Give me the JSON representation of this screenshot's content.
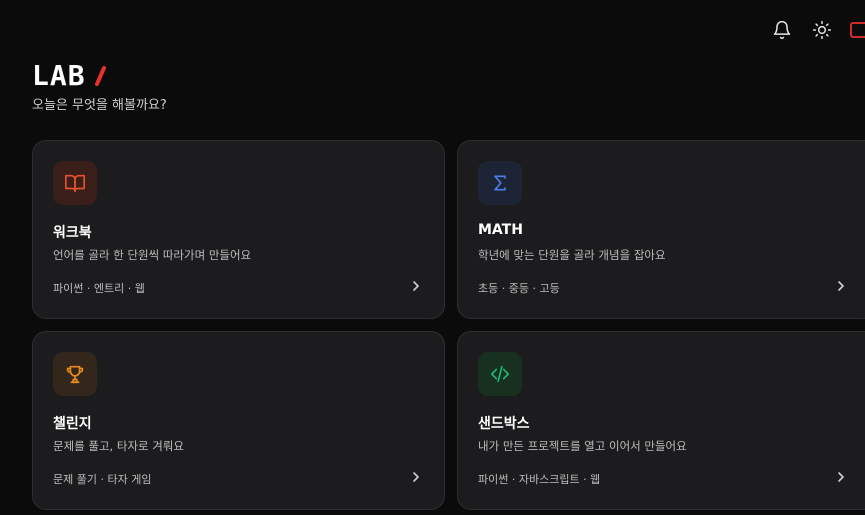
{
  "topbar": {
    "icons": [
      "bell-icon",
      "sun-icon",
      "partial-icon"
    ]
  },
  "header": {
    "logo_text": "LAB",
    "logo_accent_color": "#e8322b",
    "subtitle": "오늘은 무엇을 해볼까요?"
  },
  "cards": [
    {
      "title": "워크북",
      "description": "언어를 골라 한 단원씩 따라가며 만들어요",
      "tags": "파이썬 · 엔트리 · 웹",
      "icon": "book-icon",
      "accent_color": "#e8512b",
      "icon_bg": "#3a1e1a"
    },
    {
      "title": "MATH",
      "description": "학년에 맞는 단원을 골라 개념을 잡아요",
      "tags": "초등 · 중등 · 고등",
      "icon": "sigma-icon",
      "accent_color": "#4c7ff0",
      "icon_bg": "#1d2436"
    },
    {
      "title": "챌린지",
      "description": "문제를 풀고, 타자로 겨뤄요",
      "tags": "문제 풀기 · 타자 게임",
      "icon": "trophy-icon",
      "accent_color": "#e8891e",
      "icon_bg": "#33261a"
    },
    {
      "title": "샌드박스",
      "description": "내가 만든 프로젝트를 열고 이어서 만들어요",
      "tags": "파이썬 · 자바스크립트 · 웹",
      "icon": "code-icon",
      "accent_color": "#25b874",
      "icon_bg": "#17301f"
    }
  ]
}
